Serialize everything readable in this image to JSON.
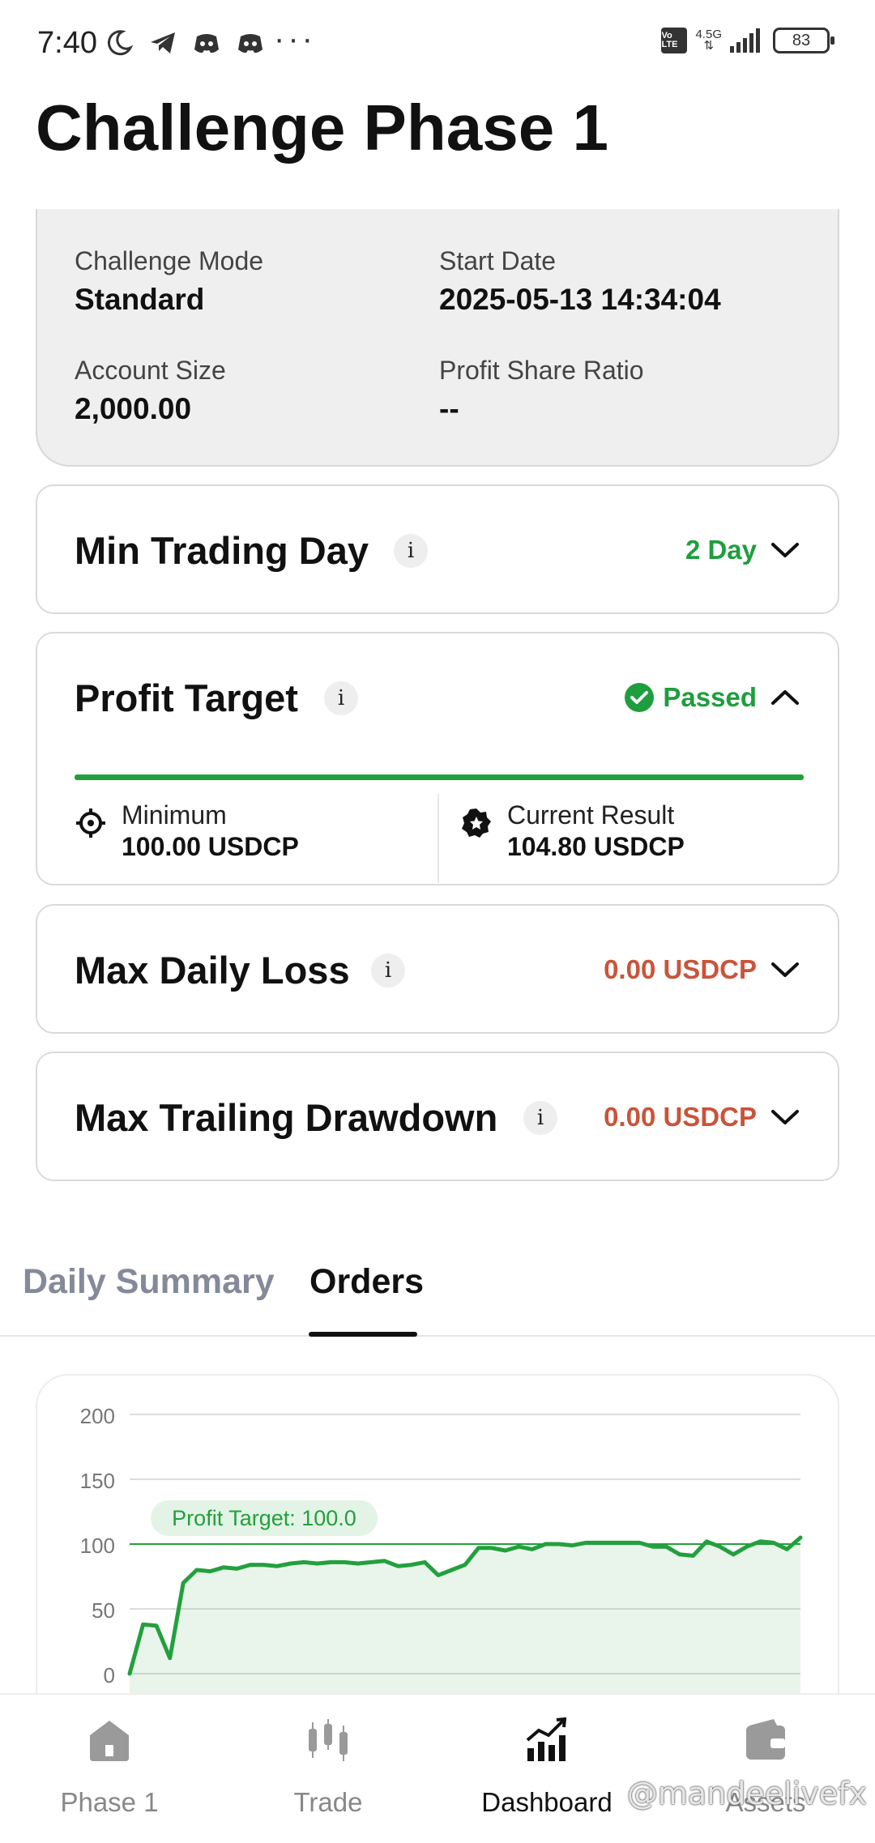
{
  "status_bar": {
    "time": "7:40",
    "network": "4.5G",
    "volte": "Vo LTE",
    "battery": "83"
  },
  "page": {
    "title": "Challenge Phase 1"
  },
  "info": {
    "challenge_mode_label": "Challenge Mode",
    "challenge_mode_value": "Standard",
    "start_date_label": "Start Date",
    "start_date_value": "2025-05-13 14:34:04",
    "account_size_label": "Account Size",
    "account_size_value": "2,000.00",
    "profit_share_label": "Profit Share Ratio",
    "profit_share_value": "--"
  },
  "rules": {
    "min_trading_day": {
      "title": "Min Trading Day",
      "status": "2 Day"
    },
    "profit_target": {
      "title": "Profit Target",
      "status": "Passed",
      "progress": 1.0,
      "minimum_label": "Minimum",
      "minimum_value": "100.00 USDCP",
      "current_label": "Current Result",
      "current_value": "104.80 USDCP"
    },
    "max_daily_loss": {
      "title": "Max Daily Loss",
      "status": "0.00 USDCP"
    },
    "max_trailing_drawdown": {
      "title": "Max Trailing Drawdown",
      "status": "0.00 USDCP"
    }
  },
  "info_badge": "i",
  "tabs": [
    {
      "label": "Daily Summary",
      "active": false
    },
    {
      "label": "Orders",
      "active": true
    }
  ],
  "chart_data": {
    "type": "area",
    "y_ticks": [
      "200",
      "150",
      "100",
      "50",
      "0"
    ],
    "ylim": [
      0,
      200
    ],
    "grid": true,
    "target_label": "Profit Target: 100.0",
    "target_value": 100,
    "color": "#23a03d",
    "values": [
      0,
      38,
      37,
      12,
      70,
      80,
      79,
      82,
      81,
      84,
      84,
      83,
      85,
      86,
      85,
      86,
      86,
      85,
      86,
      87,
      83,
      84,
      86,
      76,
      80,
      84,
      97,
      97,
      95,
      98,
      96,
      100,
      100,
      99,
      101,
      101,
      101,
      101,
      101,
      98,
      98,
      92,
      91,
      102,
      98,
      92,
      98,
      102,
      101,
      96,
      105
    ]
  },
  "nav": [
    {
      "label": "Phase 1",
      "icon": "home-icon",
      "active": false
    },
    {
      "label": "Trade",
      "icon": "candlestick-icon",
      "active": false
    },
    {
      "label": "Dashboard",
      "icon": "chart-trend-icon",
      "active": true
    },
    {
      "label": "Assets",
      "icon": "wallet-icon",
      "active": false
    }
  ],
  "watermark": "@mandeelivefx"
}
